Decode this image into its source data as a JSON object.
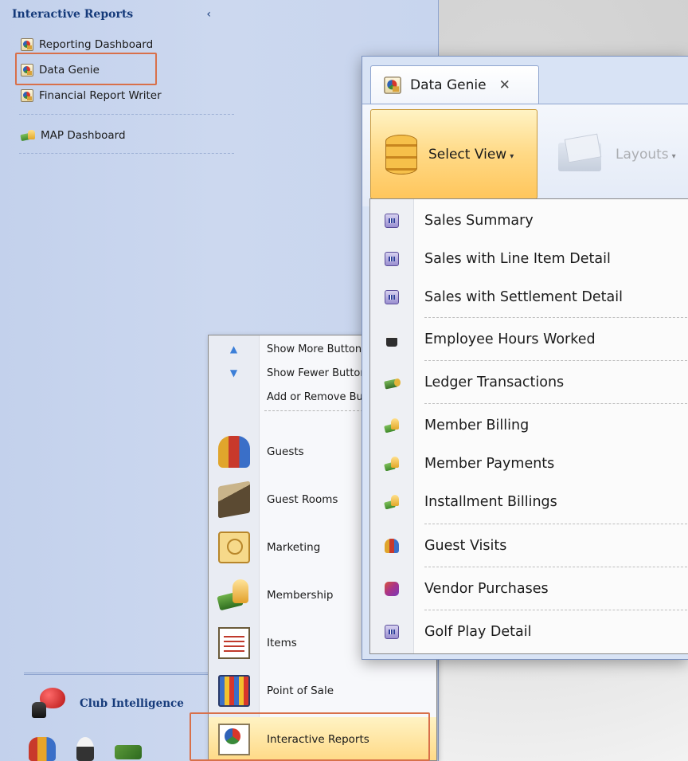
{
  "left_pane": {
    "header": "Interactive Reports",
    "collapse_icon": "chevron-left-icon",
    "links": [
      {
        "label": "Reporting Dashboard",
        "icon": "report-icon"
      },
      {
        "label": "Data Genie",
        "icon": "report-icon",
        "highlighted": true
      },
      {
        "label": "Financial Report Writer",
        "icon": "report-icon"
      },
      {
        "label": "MAP Dashboard",
        "icon": "map-dashboard-icon"
      }
    ],
    "club_intelligence": "Club Intelligence"
  },
  "nav_menu": {
    "small_items": [
      {
        "label": "Show More Buttons",
        "icon": "arrow-up-icon"
      },
      {
        "label": "Show Fewer Buttons",
        "icon": "arrow-down-icon"
      },
      {
        "label": "Add or Remove Buttons",
        "icon": ""
      }
    ],
    "big_items": [
      {
        "label": "Guests",
        "icon": "guests-icon"
      },
      {
        "label": "Guest Rooms",
        "icon": "guest-rooms-icon"
      },
      {
        "label": "Marketing",
        "icon": "marketing-icon"
      },
      {
        "label": "Membership",
        "icon": "membership-icon"
      },
      {
        "label": "Items",
        "icon": "items-icon"
      },
      {
        "label": "Point of Sale",
        "icon": "point-of-sale-icon"
      },
      {
        "label": "Interactive Reports",
        "icon": "interactive-reports-icon",
        "selected": true
      }
    ]
  },
  "data_genie": {
    "tab_label": "Data Genie",
    "close_glyph": "✕",
    "select_view_label": "Select View",
    "layouts_label": "Layouts",
    "caret": "▾",
    "views": [
      {
        "label": "Sales Summary",
        "icon": "sales-icon"
      },
      {
        "label": "Sales with Line Item Detail",
        "icon": "sales-icon"
      },
      {
        "label": "Sales with Settlement Detail",
        "icon": "sales-icon"
      },
      {
        "label": "Employee Hours Worked",
        "icon": "employee-icon"
      },
      {
        "label": "Ledger Transactions",
        "icon": "ledger-icon"
      },
      {
        "label": "Member Billing",
        "icon": "member-icon"
      },
      {
        "label": "Member Payments",
        "icon": "member-icon"
      },
      {
        "label": "Installment Billings",
        "icon": "member-icon"
      },
      {
        "label": "Guest Visits",
        "icon": "guests-icon"
      },
      {
        "label": "Vendor Purchases",
        "icon": "vendor-icon"
      },
      {
        "label": "Golf Play Detail",
        "icon": "golf-icon"
      }
    ]
  },
  "colors": {
    "pane_blue": "#c8d5ee",
    "header_text": "#153a7a",
    "highlight_outline": "#d8704a",
    "selected_gold": "#ffd985"
  }
}
